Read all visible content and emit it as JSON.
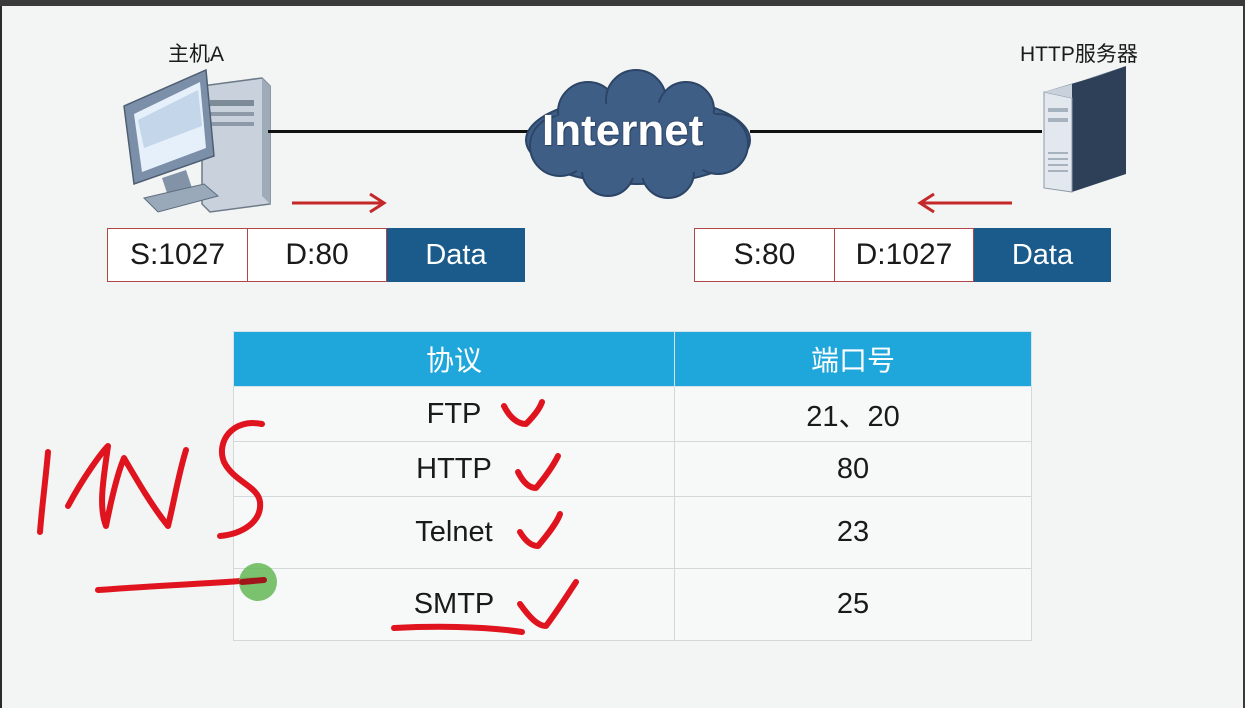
{
  "diagram": {
    "host": {
      "label": "主机A",
      "icon": "desktop-computer-icon"
    },
    "server": {
      "label": "HTTP服务器",
      "icon": "server-tower-icon"
    },
    "cloud": {
      "label": "Internet",
      "icon": "cloud-icon"
    },
    "request_packet": {
      "source": "S:1027",
      "destination": "D:80",
      "payload": "Data",
      "direction": "right"
    },
    "response_packet": {
      "source": "S:80",
      "destination": "D:1027",
      "payload": "Data",
      "direction": "left"
    }
  },
  "port_table": {
    "headers": [
      "协议",
      "端口号"
    ],
    "rows": [
      {
        "protocol": "FTP",
        "port": "21、20"
      },
      {
        "protocol": "HTTP",
        "port": "80"
      },
      {
        "protocol": "Telnet",
        "port": "23"
      },
      {
        "protocol": "SMTP",
        "port": "25"
      }
    ]
  },
  "annotations": {
    "handwritten_note": "DNS",
    "checkmark_count": 4,
    "ink_color": "#e0141e",
    "pointer_color": "#6dbb5e"
  },
  "colors": {
    "header_blue": "#1fa7dc",
    "data_cell_blue": "#1b5b8c",
    "arrow_red": "#c42828",
    "cloud_blue": "#3f5e86"
  }
}
